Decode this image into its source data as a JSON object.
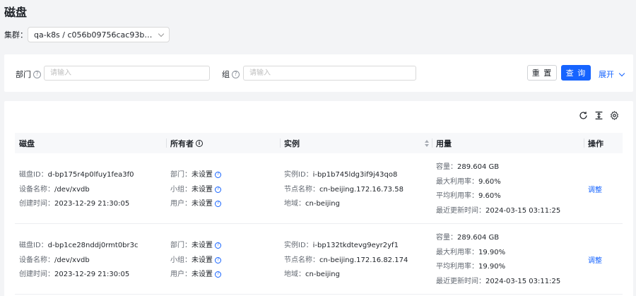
{
  "page": {
    "title": "磁盘"
  },
  "cluster": {
    "label": "集群：",
    "value": "qa-k8s / c056b09756cac93b22f1ac2..."
  },
  "filters": {
    "department": {
      "label": "部门",
      "placeholder": "请输入"
    },
    "group": {
      "label": "组",
      "placeholder": "请输入"
    },
    "reset_label": "重 置",
    "query_label": "查 询",
    "expand_label": "展开"
  },
  "toolbar": {
    "icons": [
      "refresh-icon",
      "column-height-icon",
      "settings-icon"
    ]
  },
  "table": {
    "headers": {
      "disk": "磁盘",
      "owner": "所有者",
      "instance": "实例",
      "usage": "用量",
      "action": "操作"
    },
    "field_labels": {
      "disk_id": "磁盘ID：",
      "device": "设备名称：",
      "created": "创建时间：",
      "dept": "部门：",
      "team": "小组：",
      "user": "用户：",
      "instance_id": "实例ID：",
      "node": "节点名称：",
      "region": "地域：",
      "capacity": "容量：",
      "max_util": "最大利用率：",
      "avg_util": "平均利用率：",
      "updated": "最近更新时间："
    },
    "rows": [
      {
        "disk_id": "d-bp175r4p0lfuy1fea3f0",
        "device": "/dev/xvdb",
        "created": "2023-12-29 21:30:05",
        "dept": "未设置",
        "team": "未设置",
        "user": "未设置",
        "instance_id": "i-bp1b745ldg3if9j43qo8",
        "node": "cn-beijing.172.16.73.58",
        "region": "cn-beijing",
        "capacity": "289.604 GB",
        "max_util": "9.60%",
        "avg_util": "9.60%",
        "updated": "2024-03-15 03:11:25",
        "action": "调整"
      },
      {
        "disk_id": "d-bp1ce28nddj0rmt0br3c",
        "device": "/dev/xvdb",
        "created": "2023-12-29 21:30:05",
        "dept": "未设置",
        "team": "未设置",
        "user": "未设置",
        "instance_id": "i-bp132tkdtevg9eyr2yf1",
        "node": "cn-beijing.172.16.82.174",
        "region": "cn-beijing",
        "capacity": "289.604 GB",
        "max_util": "19.90%",
        "avg_util": "19.90%",
        "updated": "2024-03-15 03:11:25",
        "action": "调整"
      }
    ]
  }
}
